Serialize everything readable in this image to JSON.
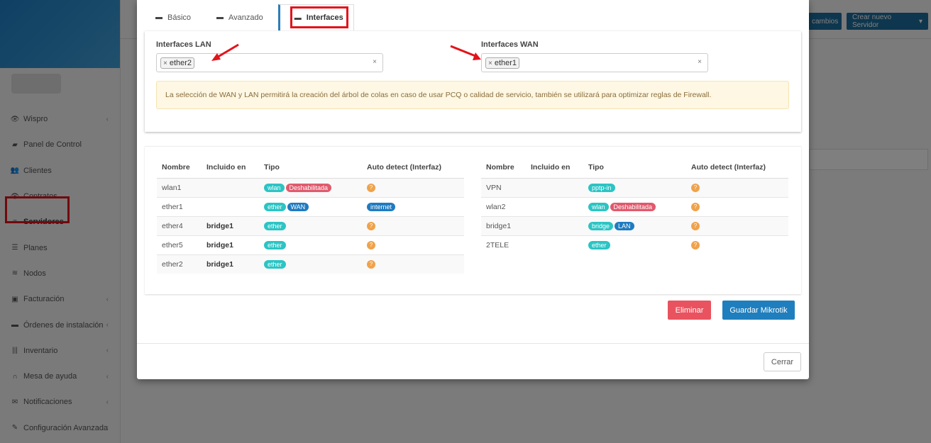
{
  "colors": {
    "teal": "#2cc4c4",
    "blue": "#1f7bc0",
    "red": "#e05a6d",
    "orange": "#f0a24a",
    "danger": "#e8535f",
    "primary": "#1f7ebd"
  },
  "sidebar": {
    "items": [
      {
        "icon": "eye-icon",
        "glyph": "👁",
        "label": "Wispro",
        "chevron": true
      },
      {
        "icon": "chart-icon",
        "glyph": "▰",
        "label": "Panel de Control",
        "chevron": false
      },
      {
        "icon": "users-icon",
        "glyph": "👥",
        "label": "Clientes",
        "chevron": false
      },
      {
        "icon": "eye-icon",
        "glyph": "👁",
        "label": "Contratos",
        "chevron": false
      },
      {
        "icon": "list-icon",
        "glyph": "≡",
        "label": "Servidores",
        "chevron": false,
        "active": true
      },
      {
        "icon": "list-icon",
        "glyph": "☰",
        "label": "Planes",
        "chevron": false
      },
      {
        "icon": "wifi-icon",
        "glyph": "≋",
        "label": "Nodos",
        "chevron": false
      },
      {
        "icon": "money-icon",
        "glyph": "▣",
        "label": "Facturación",
        "chevron": true
      },
      {
        "icon": "truck-icon",
        "glyph": "▬",
        "label": "Órdenes de instalación",
        "chevron": true
      },
      {
        "icon": "barcode-icon",
        "glyph": "|||",
        "label": "Inventario",
        "chevron": true
      },
      {
        "icon": "headset-icon",
        "glyph": "∩",
        "label": "Mesa de ayuda",
        "chevron": true
      },
      {
        "icon": "envelope-icon",
        "glyph": "✉",
        "label": "Notificaciones",
        "chevron": true
      },
      {
        "icon": "wrench-icon",
        "glyph": "✎",
        "label": "Configuración Avanzada",
        "chevron": true
      }
    ]
  },
  "topbar": {
    "changes_label": "cambios",
    "create_server_label": "Crear nuevo Servidor"
  },
  "modal": {
    "tabs": [
      {
        "label": "Básico"
      },
      {
        "label": "Avanzado"
      },
      {
        "label": "Interfaces"
      }
    ],
    "lan": {
      "label": "Interfaces LAN",
      "chip": "ether2",
      "clear": "×"
    },
    "wan": {
      "label": "Interfaces WAN",
      "chip": "ether1",
      "clear": "×"
    },
    "alert": "La selección de WAN y LAN permitirá la creación del árbol de colas en caso de usar PCQ o calidad de servicio, también se utilizará para optimizar reglas de Firewall.",
    "headers": [
      "Nombre",
      "Incluido en",
      "Tipo",
      "Auto detect (Interfaz)"
    ],
    "left_rows": [
      {
        "name": "wlan1",
        "included": "",
        "tags": [
          {
            "text": "wlan",
            "color": "teal"
          },
          {
            "text": "Deshabilitada",
            "color": "red"
          }
        ],
        "auto": {
          "type": "q",
          "text": "?"
        }
      },
      {
        "name": "ether1",
        "included": "",
        "tags": [
          {
            "text": "ether",
            "color": "teal"
          },
          {
            "text": "WAN",
            "color": "blue"
          }
        ],
        "auto": {
          "type": "label",
          "text": "internet"
        }
      },
      {
        "name": "ether4",
        "included": "bridge1",
        "tags": [
          {
            "text": "ether",
            "color": "teal"
          }
        ],
        "auto": {
          "type": "q",
          "text": "?"
        }
      },
      {
        "name": "ether5",
        "included": "bridge1",
        "tags": [
          {
            "text": "ether",
            "color": "teal"
          }
        ],
        "auto": {
          "type": "q",
          "text": "?"
        }
      },
      {
        "name": "ether2",
        "included": "bridge1",
        "tags": [
          {
            "text": "ether",
            "color": "teal"
          }
        ],
        "auto": {
          "type": "q",
          "text": "?"
        }
      }
    ],
    "right_rows": [
      {
        "name": "VPN",
        "included": "",
        "tags": [
          {
            "text": "pptp-in",
            "color": "teal"
          }
        ],
        "auto": {
          "type": "q",
          "text": "?"
        }
      },
      {
        "name": "wlan2",
        "included": "",
        "tags": [
          {
            "text": "wlan",
            "color": "teal"
          },
          {
            "text": "Deshabilitada",
            "color": "red"
          }
        ],
        "auto": {
          "type": "q",
          "text": "?"
        }
      },
      {
        "name": "bridge1",
        "included": "",
        "tags": [
          {
            "text": "bridge",
            "color": "teal"
          },
          {
            "text": "LAN",
            "color": "blue"
          }
        ],
        "auto": {
          "type": "q",
          "text": "?"
        }
      },
      {
        "name": "2TELE",
        "included": "",
        "tags": [
          {
            "text": "ether",
            "color": "teal"
          }
        ],
        "auto": {
          "type": "q",
          "text": "?"
        }
      }
    ],
    "delete_label": "Eliminar",
    "save_label": "Guardar Mikrotik",
    "close_label": "Cerrar"
  }
}
